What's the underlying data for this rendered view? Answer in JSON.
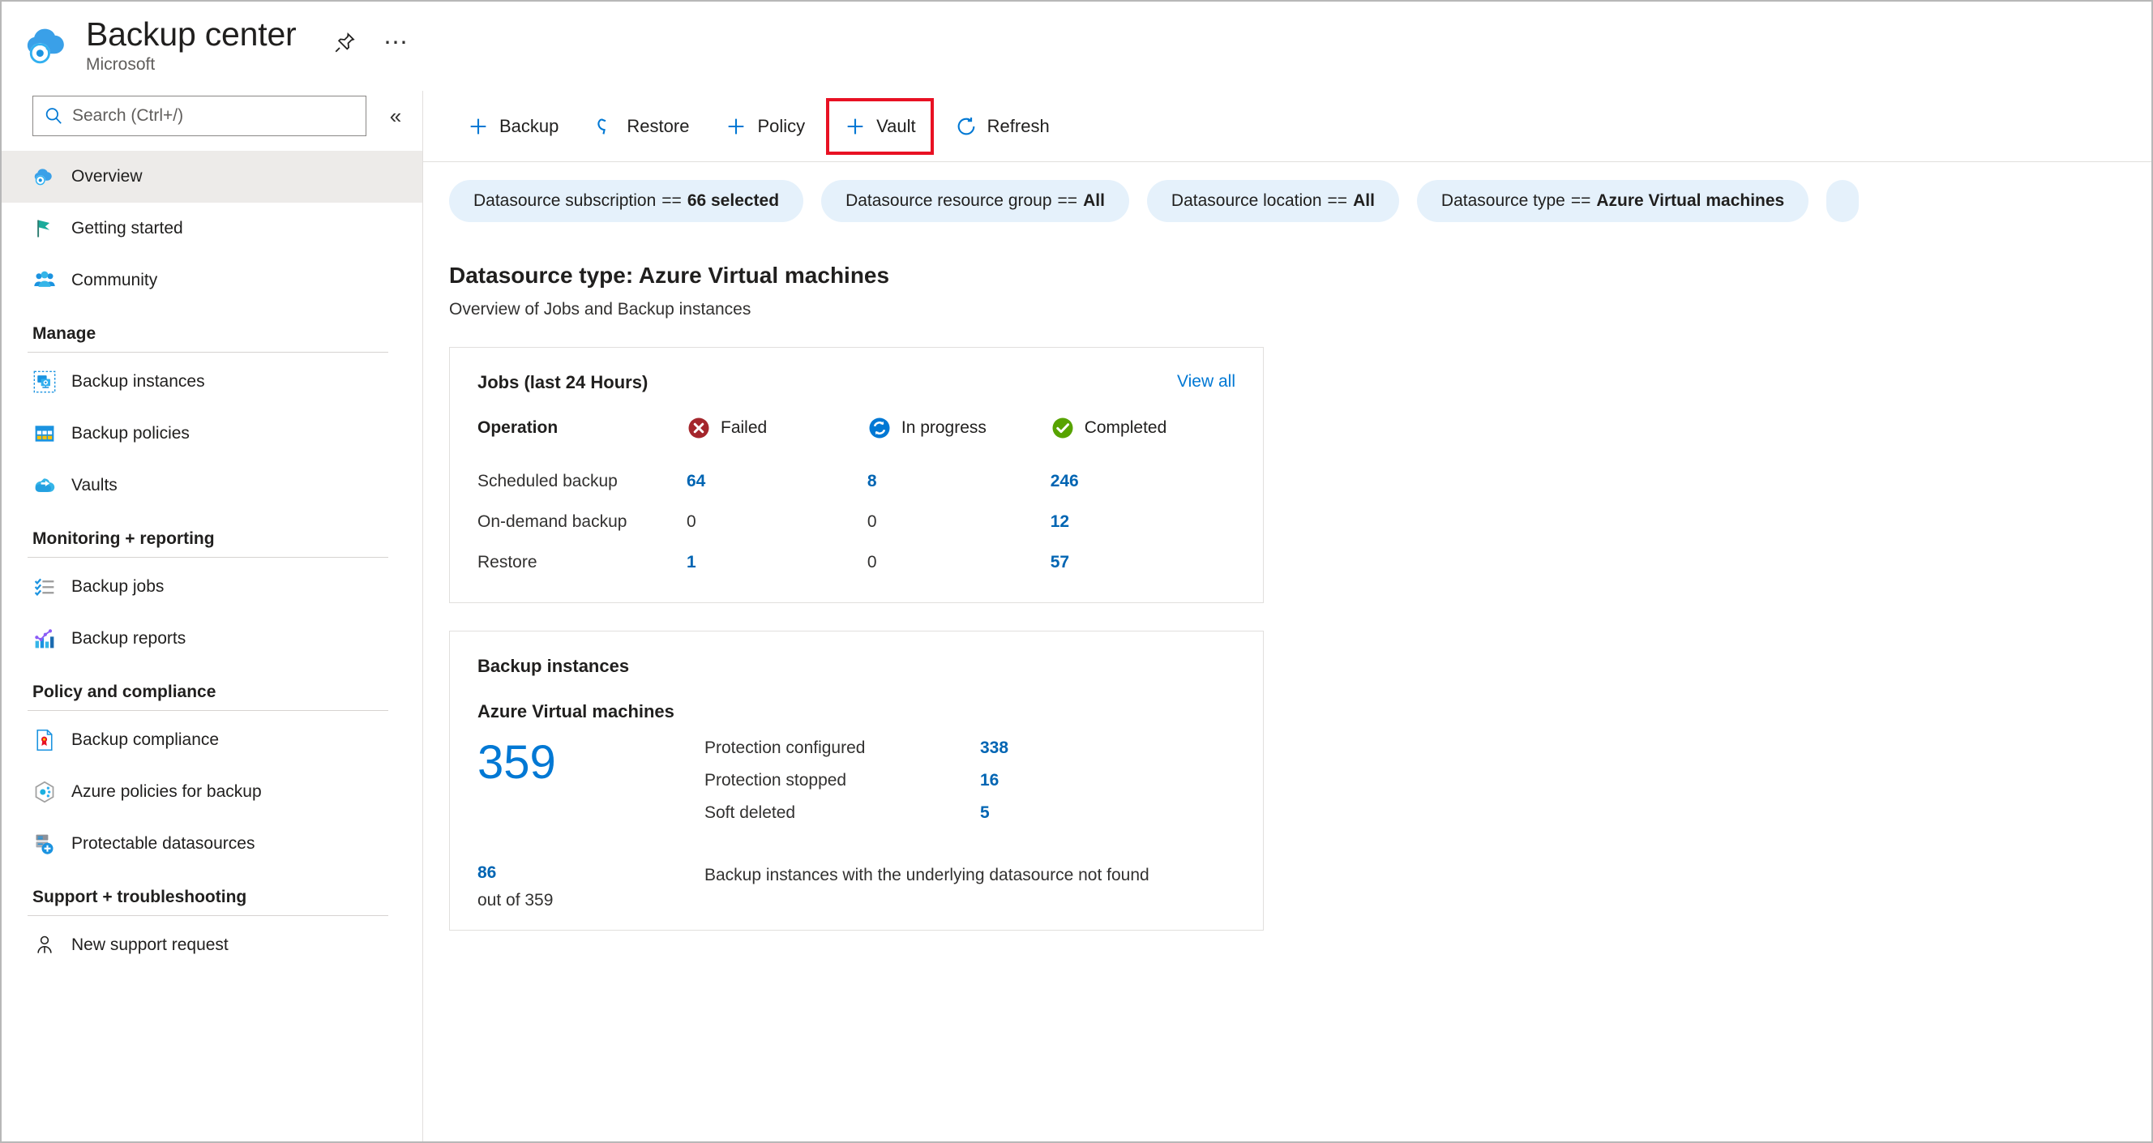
{
  "header": {
    "title": "Backup center",
    "subtitle": "Microsoft",
    "logo_icon": "backup-center-cloud-icon",
    "pin_icon": "pin-icon",
    "more_icon": "ellipsis-icon"
  },
  "search": {
    "placeholder": "Search (Ctrl+/)",
    "value": "",
    "icon": "search-icon",
    "collapse_icon": "chevron-double-left-icon"
  },
  "sidebar": {
    "top_items": [
      {
        "label": "Overview",
        "icon": "overview-cloud-icon",
        "selected": true
      },
      {
        "label": "Getting started",
        "icon": "flag-icon",
        "selected": false
      },
      {
        "label": "Community",
        "icon": "people-icon",
        "selected": false
      }
    ],
    "groups": [
      {
        "title": "Manage",
        "items": [
          {
            "label": "Backup instances",
            "icon": "backup-instances-icon"
          },
          {
            "label": "Backup policies",
            "icon": "backup-policies-grid-icon"
          },
          {
            "label": "Vaults",
            "icon": "vault-cloud-icon"
          }
        ]
      },
      {
        "title": "Monitoring + reporting",
        "items": [
          {
            "label": "Backup jobs",
            "icon": "checklist-icon"
          },
          {
            "label": "Backup reports",
            "icon": "bar-chart-icon"
          }
        ]
      },
      {
        "title": "Policy and compliance",
        "items": [
          {
            "label": "Backup compliance",
            "icon": "certificate-document-icon"
          },
          {
            "label": "Azure policies for backup",
            "icon": "azure-policy-hexagon-icon"
          },
          {
            "label": "Protectable datasources",
            "icon": "datasource-server-plus-icon"
          }
        ]
      },
      {
        "title": "Support + troubleshooting",
        "items": [
          {
            "label": "New support request",
            "icon": "support-person-icon"
          }
        ]
      }
    ]
  },
  "command_bar": {
    "items": [
      {
        "label": "Backup",
        "icon": "plus-icon",
        "highlighted": false
      },
      {
        "label": "Restore",
        "icon": "restore-undo-icon",
        "highlighted": false
      },
      {
        "label": "Policy",
        "icon": "plus-icon",
        "highlighted": false
      },
      {
        "label": "Vault",
        "icon": "plus-icon",
        "highlighted": true
      },
      {
        "label": "Refresh",
        "icon": "refresh-icon",
        "highlighted": false
      }
    ],
    "highlight_color": "#e81123"
  },
  "filters": [
    {
      "name": "Datasource subscription",
      "operator": "==",
      "value": "66 selected",
      "partial": false
    },
    {
      "name": "Datasource resource group",
      "operator": "==",
      "value": "All",
      "partial": false
    },
    {
      "name": "Datasource location",
      "operator": "==",
      "value": "All",
      "partial": false
    },
    {
      "name": "Datasource type",
      "operator": "==",
      "value": "Azure Virtual machines",
      "partial": false
    },
    {
      "name": "",
      "operator": "",
      "value": "",
      "partial": true
    }
  ],
  "page": {
    "title": "Datasource type: Azure Virtual machines",
    "subtitle": "Overview of Jobs and Backup instances"
  },
  "jobs_card": {
    "title": "Jobs (last 24 Hours)",
    "view_all": "View all",
    "columns": [
      {
        "label": "Operation",
        "icon": ""
      },
      {
        "label": "Failed",
        "icon": "failed-error-icon",
        "color": "#a4262c"
      },
      {
        "label": "In progress",
        "icon": "in-progress-sync-icon",
        "color": "#0078d4"
      },
      {
        "label": "Completed",
        "icon": "completed-check-icon",
        "color": "#57a300"
      }
    ],
    "rows": [
      {
        "operation": "Scheduled backup",
        "failed": "64",
        "in_progress": "8",
        "completed": "246"
      },
      {
        "operation": "On-demand backup",
        "failed": "0",
        "in_progress": "0",
        "completed": "12"
      },
      {
        "operation": "Restore",
        "failed": "1",
        "in_progress": "0",
        "completed": "57"
      }
    ]
  },
  "instances_card": {
    "title": "Backup instances",
    "subtitle": "Azure Virtual machines",
    "total": "359",
    "metrics": [
      {
        "label": "Protection configured",
        "value": "338"
      },
      {
        "label": "Protection stopped",
        "value": "16"
      },
      {
        "label": "Soft deleted",
        "value": "5"
      }
    ],
    "not_found": {
      "count": "86",
      "out_of": "out of 359",
      "description": "Backup instances with the underlying datasource not found"
    }
  },
  "colors": {
    "accent": "#0078d4",
    "link": "#0065b3",
    "chip_bg": "#e5f1fb",
    "selected_bg": "#edebe9",
    "highlight": "#e81123"
  }
}
